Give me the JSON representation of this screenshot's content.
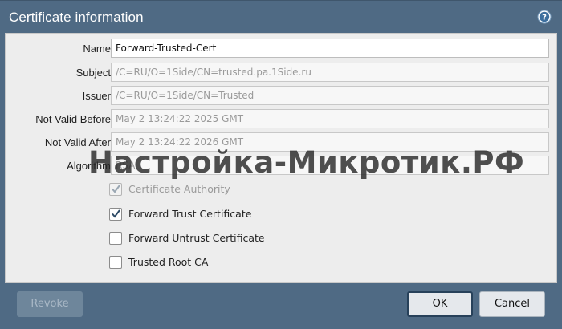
{
  "dialog": {
    "title": "Certificate information",
    "help_icon": "help-icon"
  },
  "fields": [
    {
      "label": "Name",
      "value": "Forward-Trusted-Cert",
      "editable": true
    },
    {
      "label": "Subject",
      "value": "/C=RU/O=1Side/CN=trusted.pa.1Side.ru",
      "editable": false
    },
    {
      "label": "Issuer",
      "value": "/C=RU/O=1Side/CN=Trusted",
      "editable": false
    },
    {
      "label": "Not Valid Before",
      "value": "May  2 13:24:22 2025 GMT",
      "editable": false
    },
    {
      "label": "Not Valid After",
      "value": "May  2 13:24:22 2026 GMT",
      "editable": false
    },
    {
      "label": "Algorithm",
      "value": "RSA",
      "editable": false
    }
  ],
  "checkboxes": [
    {
      "label": "Certificate Authority",
      "checked": true,
      "disabled": true
    },
    {
      "label": "Forward Trust Certificate",
      "checked": true,
      "disabled": false
    },
    {
      "label": "Forward Untrust Certificate",
      "checked": false,
      "disabled": false
    },
    {
      "label": "Trusted Root CA",
      "checked": false,
      "disabled": false
    }
  ],
  "buttons": {
    "revoke": "Revoke",
    "ok": "OK",
    "cancel": "Cancel"
  },
  "watermark": "Настройка-Микротик.РФ",
  "colors": {
    "frame": "#4f6a84",
    "panel": "#ededed",
    "check": "#2d4a66"
  }
}
